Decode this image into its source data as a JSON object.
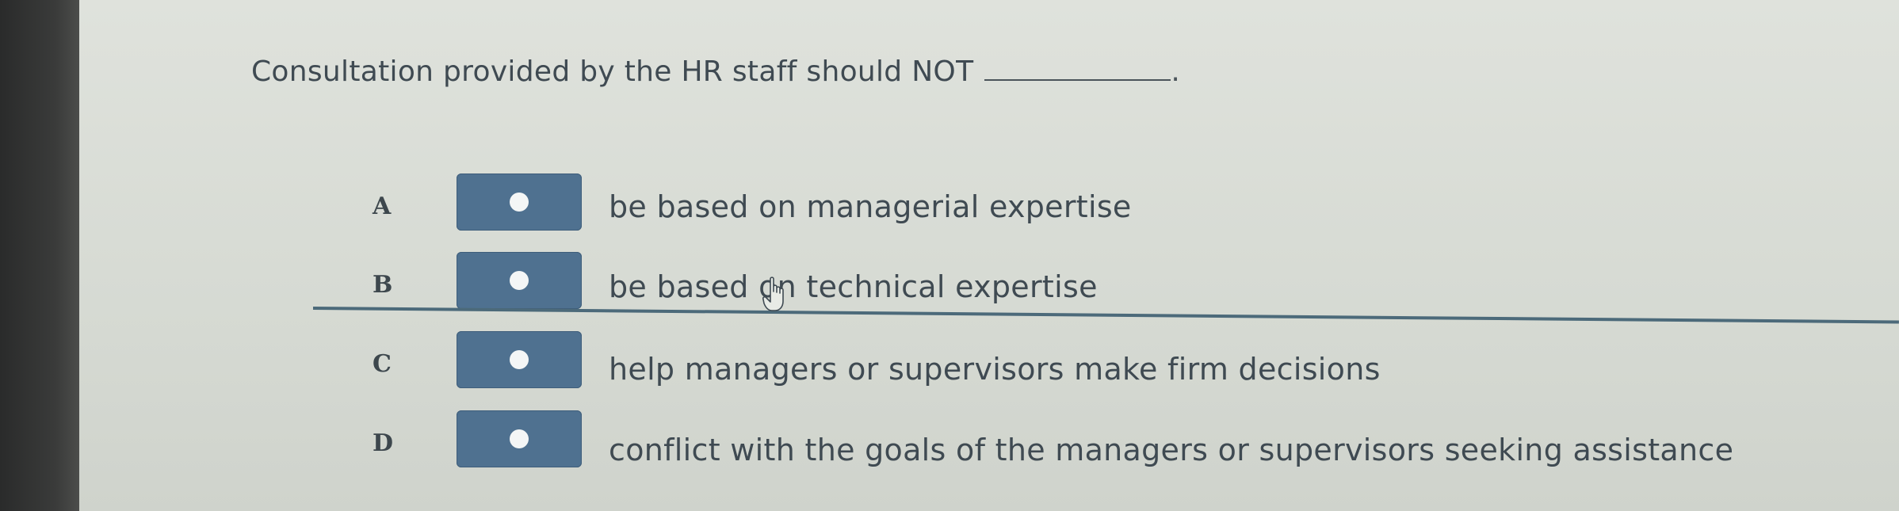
{
  "question": {
    "text": "Consultation provided by the HR staff should NOT",
    "blank_trailing": "."
  },
  "options": [
    {
      "letter": "A",
      "text": "be based on managerial expertise"
    },
    {
      "letter": "B",
      "text": "be based on technical expertise"
    },
    {
      "letter": "C",
      "text": "help managers or supervisors make firm decisions"
    },
    {
      "letter": "D",
      "text": "conflict with the goals of the managers or supervisors seeking assistance"
    }
  ],
  "colors": {
    "radio": "#4f7190",
    "text": "#3f4a52",
    "divider": "#4c6a7a"
  },
  "icons": {
    "cursor": "hand-pointer-icon"
  }
}
